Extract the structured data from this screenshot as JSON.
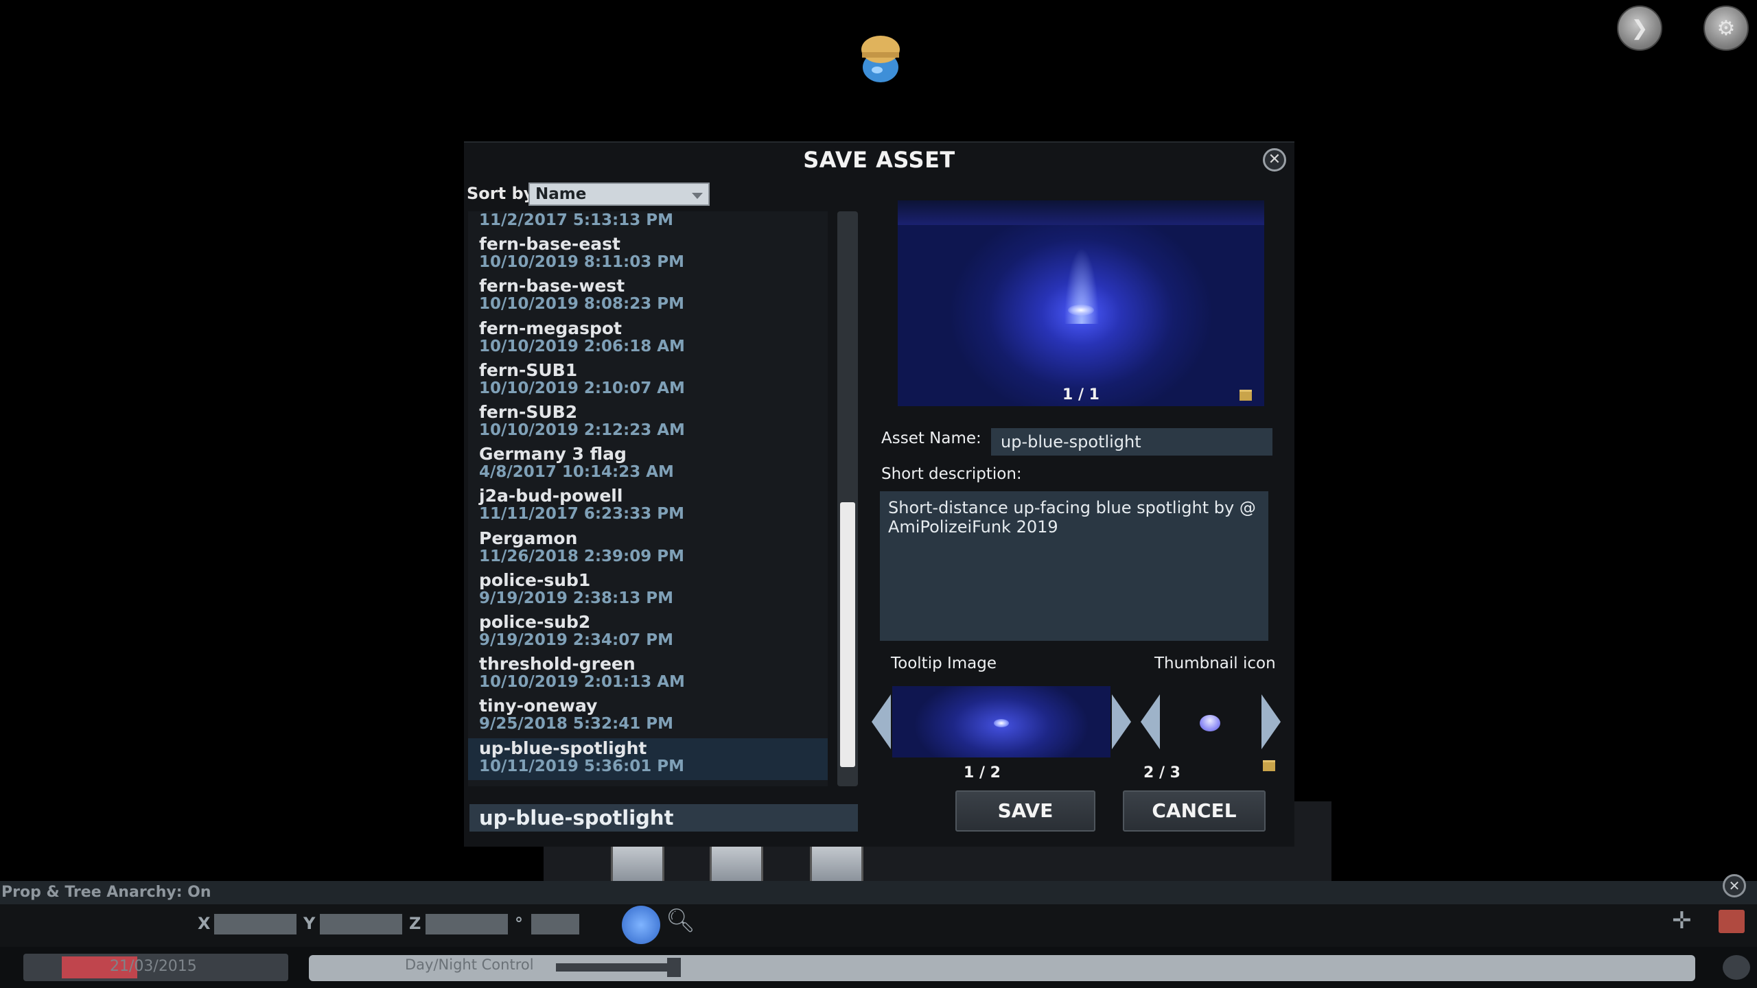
{
  "dialog": {
    "title": "SAVE ASSET",
    "sort_label": "Sort by",
    "sort_value": "Name",
    "items": [
      {
        "name": "",
        "date": "11/2/2017 5:13:13 PM"
      },
      {
        "name": "fern-base-east",
        "date": "10/10/2019 8:11:03 PM"
      },
      {
        "name": "fern-base-west",
        "date": "10/10/2019 8:08:23 PM"
      },
      {
        "name": "fern-megaspot",
        "date": "10/10/2019 2:06:18 AM"
      },
      {
        "name": "fern-SUB1",
        "date": "10/10/2019 2:10:07 AM"
      },
      {
        "name": "fern-SUB2",
        "date": "10/10/2019 2:12:23 AM"
      },
      {
        "name": "Germany 3 flag",
        "date": "4/8/2017 10:14:23 AM"
      },
      {
        "name": "j2a-bud-powell",
        "date": "11/11/2017 6:23:33 PM"
      },
      {
        "name": "Pergamon",
        "date": "11/26/2018 2:39:09 PM"
      },
      {
        "name": "police-sub1",
        "date": "9/19/2019 2:38:13 PM"
      },
      {
        "name": "police-sub2",
        "date": "9/19/2019 2:34:07 PM"
      },
      {
        "name": "threshold-green",
        "date": "10/10/2019 2:01:13 AM"
      },
      {
        "name": "tiny-oneway",
        "date": "9/25/2018 5:32:41 PM"
      },
      {
        "name": "up-blue-spotlight",
        "date": "10/11/2019 5:36:01 PM"
      }
    ],
    "selected_index": 13,
    "file_name_value": "up-blue-spotlight",
    "preview_counter": "1 / 1",
    "asset_name_label": "Asset Name:",
    "asset_name_value": "up-blue-spotlight",
    "short_desc_label": "Short description:",
    "short_desc_value": "Short-distance up-facing blue spotlight by @ AmiPolizeiFunk 2019",
    "tooltip_label": "Tooltip Image",
    "thumbnail_label": "Thumbnail icon",
    "tooltip_counter": "1 / 2",
    "thumbnail_counter": "2 / 3",
    "save_label": "SAVE",
    "cancel_label": "CANCEL"
  },
  "status": {
    "anarchy_text": "Prop & Tree Anarchy: On"
  },
  "coords": {
    "x_label": "X",
    "y_label": "Y",
    "z_label": "Z",
    "deg_label": "°"
  },
  "timebar": {
    "date": "21/03/2015",
    "daynight_label": "Day/Night Control"
  },
  "icons": {
    "top_right_1": "next-arrow-icon",
    "top_right_2": "settings-icon",
    "mascot": "chirper-icon"
  },
  "colors": {
    "dialog_bg": "#121417",
    "selected_row": "#1c2c3c",
    "date_text": "#7fa0b7",
    "field_bg": "#2c3945",
    "arrow": "#9eb3c9"
  }
}
